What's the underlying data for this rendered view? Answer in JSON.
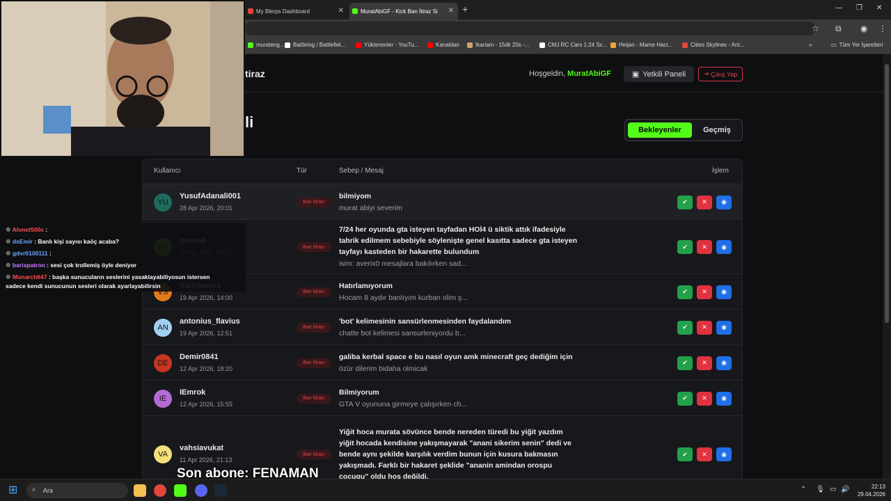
{
  "browser": {
    "tabs": [
      {
        "label": "My Blerps Dashboard"
      },
      {
        "label": "MuratAbiGF - Kick Ban İtiraz Si"
      }
    ],
    "new_tab_label": "+",
    "bookmarks": [
      {
        "label": "murateng...",
        "color": "#53fc18"
      },
      {
        "label": "Battlelog / Battlefiel...",
        "color": "#ffffff"
      },
      {
        "label": "Yüklenenler - YouTu...",
        "color": "#ff0000"
      },
      {
        "label": "Kanaldan",
        "color": "#ff0000"
      },
      {
        "label": "Ikariam - 15dk 20s -...",
        "color": "#c9a36a"
      },
      {
        "label": "CMJ RC Cars 1:24 Sc...",
        "color": "#ffffff"
      },
      {
        "label": "Heijan - Mame Haci...",
        "color": "#f2a33a"
      },
      {
        "label": "Cities Skylines - Ant...",
        "color": "#e0473a"
      }
    ],
    "all_bookmarks_label": "Tüm Yer İşaretleri"
  },
  "header": {
    "brand_suffix": "tiraz",
    "welcome_prefix": "Hoşgeldin,",
    "username": "MuratAbiGF",
    "panel_button": "Yetkili Paneli",
    "logout_button": "Çıkış Yap"
  },
  "main": {
    "title_suffix": "li",
    "tabs": {
      "active": "Bekleyenler",
      "inactive": "Geçmiş"
    },
    "table": {
      "columns": {
        "user": "Kullanıcı",
        "type": "Tür",
        "reason": "Sebep / Mesaj",
        "action": "İşlem"
      },
      "rows": [
        {
          "initials": "YU",
          "avatar_color": "#1f6b5e",
          "user": "YusufAdanali001",
          "date": "28 Apr 2026, 20:01",
          "type": "Ban İtirazı",
          "title_lines": [
            "bilmiyom"
          ],
          "sub": "murat abiyi severim"
        },
        {
          "initials": "AV",
          "avatar_color": "#8bc21b",
          "user": "averix0",
          "date": "20 Apr 2026, 18:22",
          "type": "Ban İtirazı",
          "title_lines": [
            "7/24 her oyunda gta isteyen tayfadan HOİ4 ü siktik attık ifadesiyle",
            "tahrik edilmem sebebiyle söylenişte genel kasıtta sadece gta isteyen",
            "tayfayı kasteden bir hakarette bulundum"
          ],
          "sub": "isim: averix0 mesajlara bakılırken sad..."
        },
        {
          "initials": "VS",
          "avatar_color": "#e27a1a",
          "user": "VsixSecure",
          "date": "19 Apr 2026, 14:00",
          "type": "Ban İtirazı",
          "title_lines": [
            "Hatırlamıyorum"
          ],
          "sub": "Hocam 8 aydır banlıyım kurban olim ş..."
        },
        {
          "initials": "AN",
          "avatar_color": "#9fd0f0",
          "user": "antonius_flavius",
          "date": "19 Apr 2026, 12:51",
          "type": "Ban İtirazı",
          "title_lines": [
            "'bot' kelimesinin sansürlenmesinden faydalandım"
          ],
          "sub": "chatte bot kelimesi sansurleniyordu b..."
        },
        {
          "initials": "DE",
          "avatar_color": "#c8361f",
          "user": "Demir0841",
          "date": "12 Apr 2026, 18:20",
          "type": "Ban İtirazı",
          "title_lines": [
            "galiba kerbal space e bu nasıl oyun amk minecraft geç dediğim için"
          ],
          "sub": "özür dilerim bidaha olmicak"
        },
        {
          "initials": "IE",
          "avatar_color": "#b66ad6",
          "user": "IEmrok",
          "date": "12 Apr 2026, 15:55",
          "type": "Ban İtirazı",
          "title_lines": [
            "Bilmiyorum"
          ],
          "sub": "GTA V oyununa girmeye çalışırken ch..."
        },
        {
          "initials": "VA",
          "avatar_color": "#f3e07a",
          "user": "vahsiavukat",
          "date": "11 Apr 2026, 21:13",
          "type": "Ban İtirazı",
          "title_lines": [
            "Yiğit hoca murata sövünce bende nereden türedi bu yiğit yazdım",
            "yiğit hocada kendisine yakışmayarak \"anani sikerim senin\" dedi ve",
            "bende aynı şekilde karşılık verdim bunun için kusura bakmasın",
            "yakışmadı. Farklı bir hakaret şeklide \"ananin amindan orospu",
            "cocugu\" oldu hoş değildi."
          ],
          "sub": ""
        }
      ]
    }
  },
  "chat": [
    {
      "user": "Ahmet500x",
      "user_color": "#ff4d4d",
      "text": ":"
    },
    {
      "user": "dsEmir",
      "user_color": "#6aa8ff",
      "text": ": Banlı kişi sayısı kaöç acaba?"
    },
    {
      "user": "gdvr0100111",
      "user_color": "#6aa8ff",
      "text": ":"
    },
    {
      "user": "barispatron",
      "user_color": "#c77dff",
      "text": ": sesi çok trollemiş öyle deniyor"
    },
    {
      "user": "Monarch647",
      "user_color": "#ff4d4d",
      "text": ": başka sunucuların seslerini yasaklayabiliyosun istersen"
    },
    {
      "user": "",
      "user_color": "#ffffff",
      "text": "sadece kendi sunucunun sesleri olarak ayarlayabilirsin"
    }
  ],
  "overlay": {
    "last_sub": "Son abone: FENAMAN"
  },
  "taskbar": {
    "search_placeholder": "Ara",
    "time": "22:13",
    "date": "29.04.2026"
  },
  "icons": {
    "approve": "check-icon",
    "reject": "close-icon",
    "view": "eye-icon",
    "panel": "panel-icon",
    "logout": "logout-icon"
  },
  "colors": {
    "accent": "#53fc18",
    "danger": "#e0323f",
    "success": "#22a04a",
    "info": "#1f6fe8"
  }
}
